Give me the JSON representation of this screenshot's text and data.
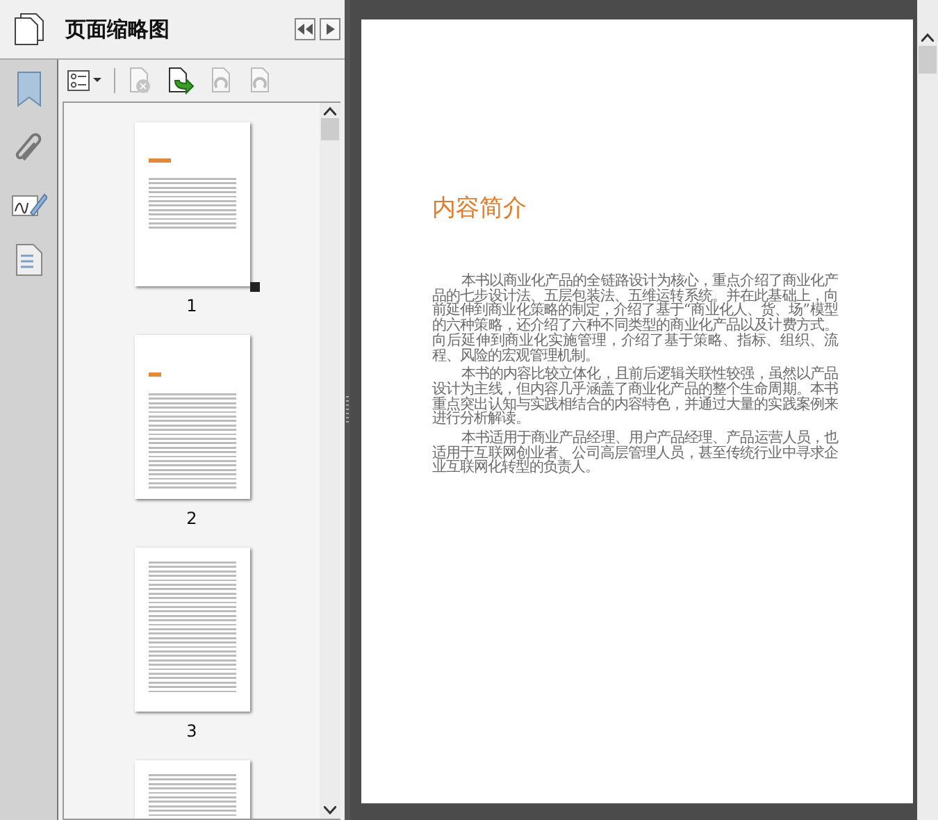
{
  "sidebar": {
    "title": "页面缩略图",
    "toolbar": [
      {
        "kind": "options",
        "disabled": false
      },
      {
        "kind": "delete",
        "disabled": true
      },
      {
        "kind": "insert",
        "disabled": false
      },
      {
        "kind": "rotate-left",
        "disabled": true
      },
      {
        "kind": "rotate-right",
        "disabled": true
      }
    ],
    "thumbnails": [
      {
        "label": "1",
        "kind": "intro",
        "selected": true
      },
      {
        "label": "2",
        "kind": "chapter",
        "selected": false
      },
      {
        "label": "3",
        "kind": "text",
        "selected": false
      },
      {
        "kind": "text",
        "selected": false
      }
    ]
  },
  "document": {
    "title": "内容简介",
    "paragraphs": [
      "本书以商业化产品的全链路设计为核心，重点介绍了商业化产品的七步设计法、五层包装法、五维运转系统。并在此基础上，向前延伸到商业化策略的制定，介绍了基于“商业化人、货、场”模型的六种策略，还介绍了六种不同类型的商业化产品以及计费方式。向后延伸到商业化实施管理，介绍了基于策略、指标、组织、流程、风险的宏观管理机制。",
      "本书的内容比较立体化，且前后逻辑关联性较强，虽然以产品设计为主线，但内容几乎涵盖了商业化产品的整个生命周期。本书重点突出认知与实践相结合的内容特色，并通过大量的实践案例来进行分析解读。",
      "本书适用于商业产品经理、用户产品经理、产品运营人员，也适用于互联网创业者、公司高层管理人员，甚至传统行业中寻求企业互联网化转型的负责人。"
    ]
  }
}
